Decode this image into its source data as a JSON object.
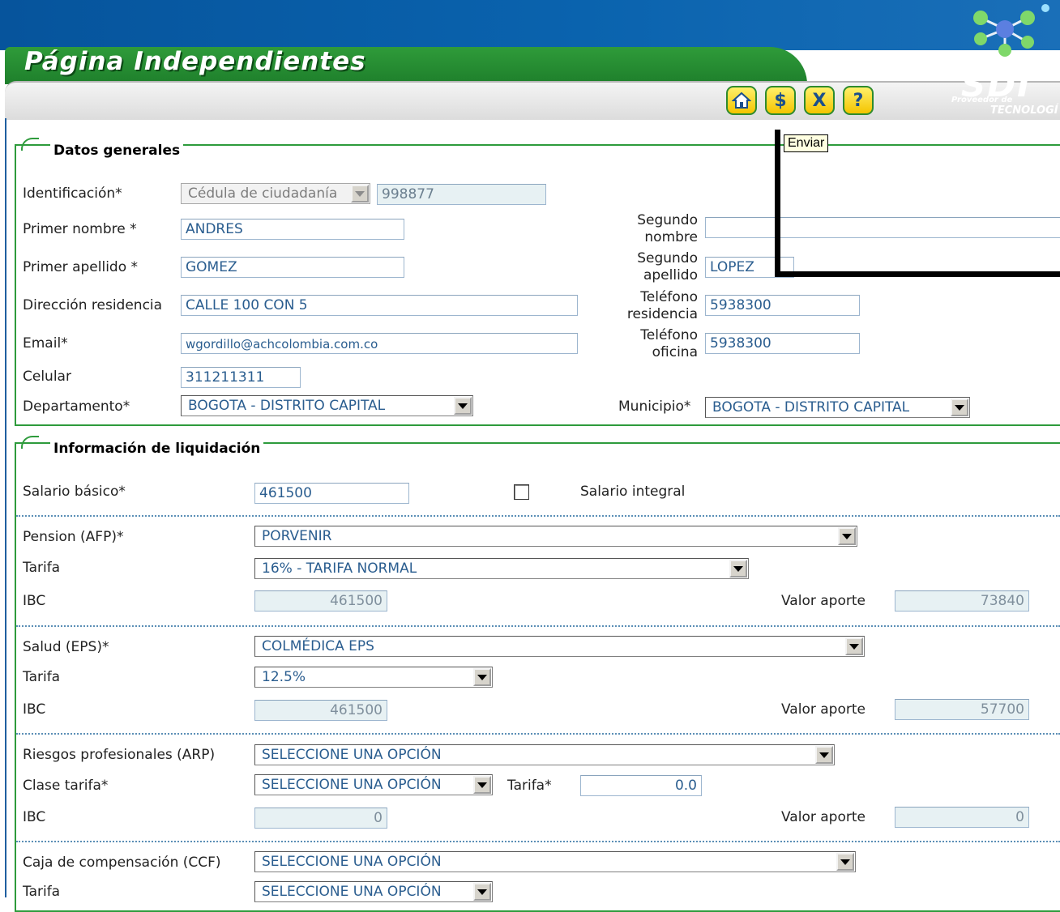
{
  "header": {
    "title": "Página Independientes",
    "logo": {
      "name": "SDI",
      "tagline_1": "Proveedor de",
      "tagline_2": "TECNOLOGÍ"
    },
    "toolbar": [
      {
        "name": "home-icon"
      },
      {
        "name": "dollar-icon",
        "glyph": "$"
      },
      {
        "name": "close-icon",
        "glyph": "X"
      },
      {
        "name": "help-icon",
        "glyph": "?"
      }
    ],
    "tooltip": "Enviar"
  },
  "datos_generales": {
    "legend": "Datos generales",
    "identificacion": {
      "label": "Identificación*",
      "tipo": "Cédula de ciudadanía",
      "numero": "998877"
    },
    "primer_nombre": {
      "label": "Primer nombre *",
      "value": "ANDRES"
    },
    "segundo_nombre": {
      "label_1": "Segundo",
      "label_2": "nombre",
      "value": ""
    },
    "primer_apellido": {
      "label": "Primer apellido *",
      "value": "GOMEZ"
    },
    "segundo_apellido": {
      "label_1": "Segundo",
      "label_2": "apellido",
      "value": "LOPEZ"
    },
    "direccion": {
      "label": "Dirección residencia",
      "value": "CALLE 100 CON 5"
    },
    "telefono_residencia": {
      "label_1": "Teléfono",
      "label_2": "residencia",
      "value": "5938300"
    },
    "email": {
      "label": "Email*",
      "value": "wgordillo@achcolombia.com.co"
    },
    "telefono_oficina": {
      "label_1": "Teléfono",
      "label_2": "oficina",
      "value": "5938300"
    },
    "celular": {
      "label": "Celular",
      "value": "311211311"
    },
    "departamento": {
      "label": "Departamento*",
      "value": "BOGOTA - DISTRITO CAPITAL"
    },
    "municipio": {
      "label": "Municipio*",
      "value": "BOGOTA - DISTRITO CAPITAL"
    }
  },
  "liquidacion": {
    "legend": "Información de liquidación",
    "salario_basico": {
      "label": "Salario básico*",
      "value": "461500"
    },
    "salario_integral": {
      "label": "Salario integral",
      "checked": false
    },
    "pension": {
      "label": "Pension (AFP)*",
      "value": "PORVENIR",
      "tarifa_label": "Tarifa",
      "tarifa": "16% - TARIFA NORMAL",
      "ibc_label": "IBC",
      "ibc": "461500",
      "aporte_label": "Valor aporte",
      "aporte": "73840"
    },
    "salud": {
      "label": "Salud (EPS)*",
      "value": "COLMÉDICA EPS",
      "tarifa_label": "Tarifa",
      "tarifa": "12.5%",
      "ibc_label": "IBC",
      "ibc": "461500",
      "aporte_label": "Valor aporte",
      "aporte": "57700"
    },
    "riesgos": {
      "label": "Riesgos profesionales (ARP)",
      "value": "SELECCIONE UNA OPCIÓN",
      "clase_label": "Clase tarifa*",
      "clase": "SELECCIONE UNA OPCIÓN",
      "tarifa_label": "Tarifa*",
      "tarifa": "0.0",
      "ibc_label": "IBC",
      "ibc": "0",
      "aporte_label": "Valor aporte",
      "aporte": "0"
    },
    "caja": {
      "label": "Caja de compensación (CCF)",
      "value": "SELECCIONE UNA OPCIÓN",
      "tarifa_label": "Tarifa",
      "tarifa": "SELECCIONE UNA OPCIÓN"
    }
  },
  "colors": {
    "header_blue": "#06549c",
    "header_green": "#2f9b3a",
    "fieldset_border": "#2e9b3c",
    "input_text": "#2a5d8f"
  }
}
